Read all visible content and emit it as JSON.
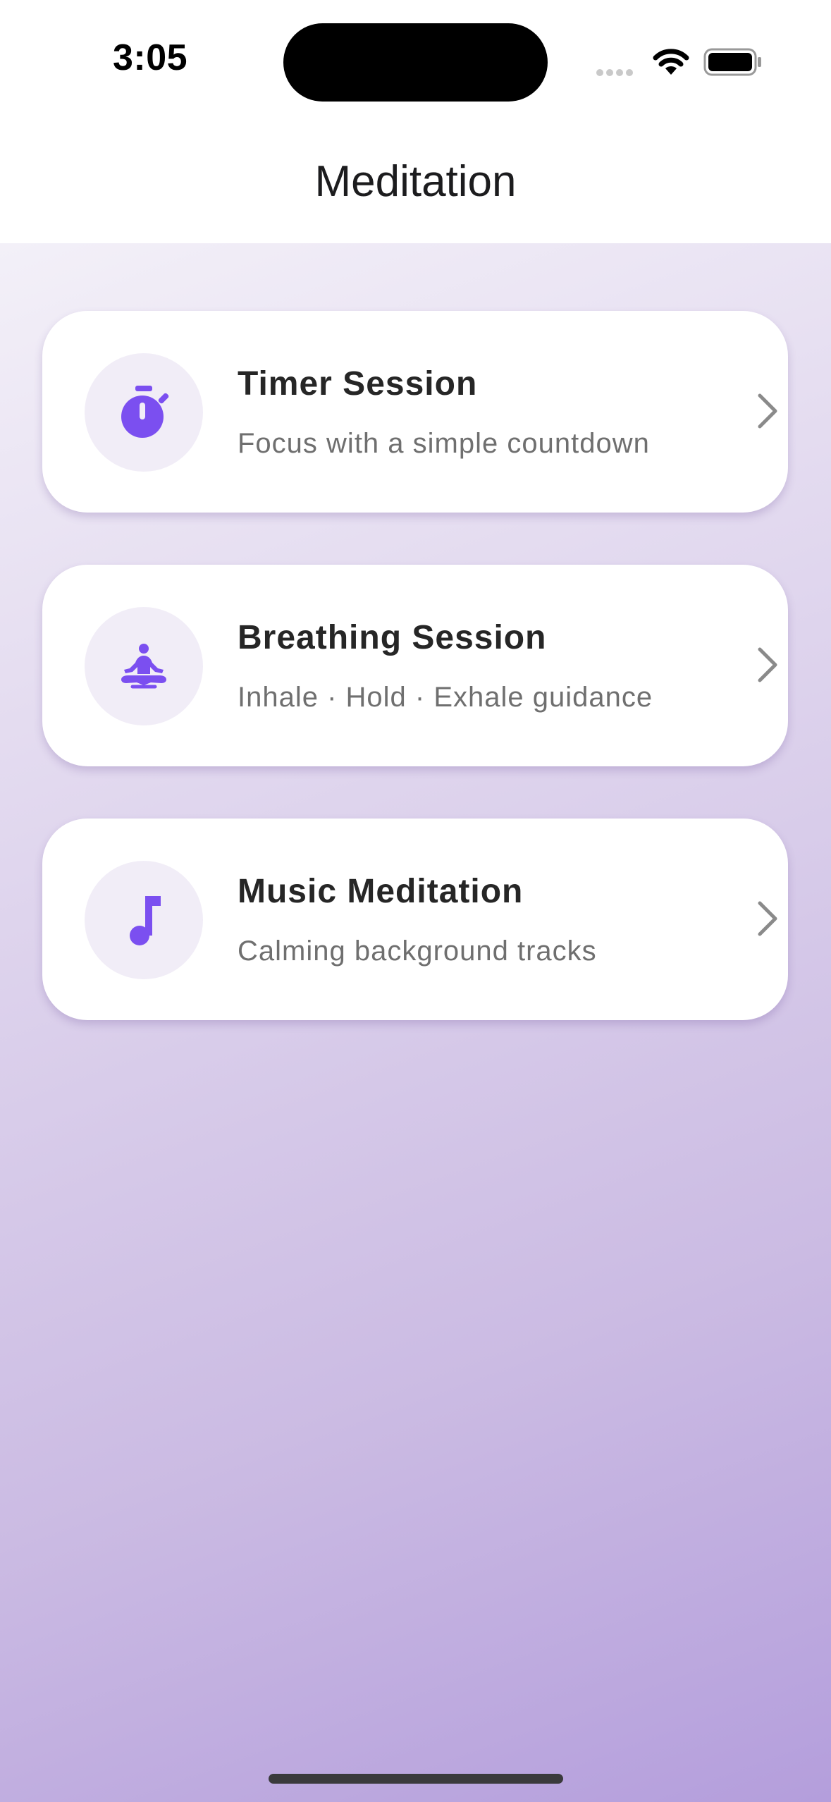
{
  "status_bar": {
    "time": "3:05"
  },
  "nav": {
    "title": "Meditation"
  },
  "colors": {
    "accent": "#7b4ff0",
    "icon_bg": "#f1edf7",
    "gradient_top": "#f3f0f8",
    "gradient_bottom": "#b49edc"
  },
  "cards": [
    {
      "icon": "stopwatch-icon",
      "title": "Timer Session",
      "subtitle": "Focus with a simple countdown"
    },
    {
      "icon": "meditation-pose-icon",
      "title": "Breathing Session",
      "subtitle": "Inhale · Hold · Exhale guidance"
    },
    {
      "icon": "music-note-icon",
      "title": "Music Meditation",
      "subtitle": "Calming background tracks"
    }
  ]
}
